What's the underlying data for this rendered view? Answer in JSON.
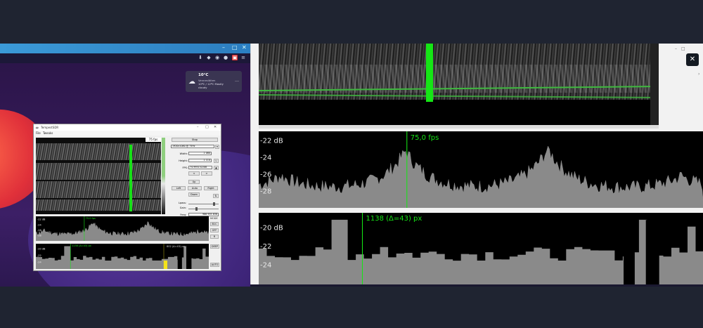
{
  "weather": {
    "temp": "10°C",
    "location": "Vennesläiten",
    "desc": "10ºC / 12ºC   Mostly cloudy",
    "icon": "cloud-sun-icon"
  },
  "tempest_small": {
    "title": "TempestSDR",
    "menu": [
      "File",
      "Tweaks"
    ],
    "fps_overlay": "75 fps",
    "stop": "Stop",
    "mode": "1920x1080 @ 75Hz",
    "width_label": "Width:",
    "width_value": "2 080",
    "height_label": "Height:",
    "height_value": "1 110",
    "fps_label": "FPS:",
    "fps_value": "74.995132208",
    "lock": "L",
    "minus": "<",
    "plus": ">",
    "up": "Up",
    "left": "Left",
    "auto": "Auto",
    "right": "Right",
    "down": "Down",
    "lpass_label": "Lpass:",
    "gain_label": "Gain:",
    "freq_label": "Freq:",
    "freq_value": "986 955 838",
    "spec1_labels": [
      "-22 dB",
      "-24",
      "-26",
      "-28"
    ],
    "spec1_marker": "75.0 fps",
    "spec2_labels": [
      "-20 dB",
      "-22",
      "-24"
    ],
    "spec2_marker": "1138 (Δ=43) px",
    "spec2_marker2": "802 (Δ=43) px",
    "side1": [
      "MODE",
      "B1C",
      "OFF",
      "R"
    ],
    "side2": [
      "DEEP",
      "AUTO"
    ]
  },
  "big": {
    "close_icon": "close-icon",
    "spec1_labels": [
      "-22 dB",
      "-24",
      "-26",
      "-28"
    ],
    "spec1_marker": "75,0 fps",
    "spec2_labels": [
      "-20 dB",
      "-22",
      "-24"
    ],
    "spec2_marker": "1138 (Δ=43) px"
  },
  "colors": {
    "accent_green": "#15e515",
    "spectrum_fill": "#8a8a8a",
    "desktop_purple": "#341a58"
  }
}
